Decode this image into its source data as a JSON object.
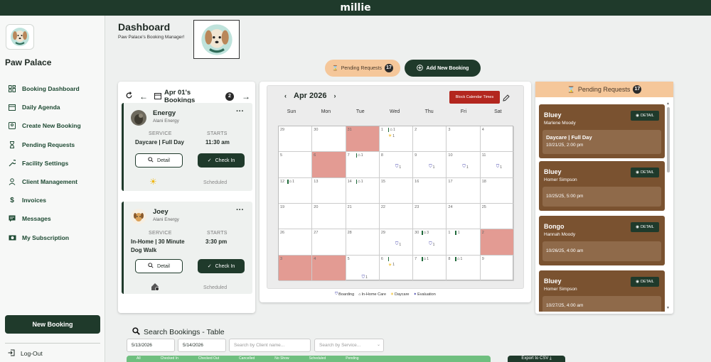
{
  "app": {
    "title": "millie"
  },
  "sidebar": {
    "brand": "Paw Palace",
    "items": [
      {
        "label": "Booking Dashboard",
        "icon": "dashboard-icon"
      },
      {
        "label": "Daily Agenda",
        "icon": "calendar-icon"
      },
      {
        "label": "Create New Booking",
        "icon": "booking-icon"
      },
      {
        "label": "Pending Requests",
        "icon": "hourglass-icon"
      },
      {
        "label": "Facility Settings",
        "icon": "wrench-icon"
      },
      {
        "label": "Client Management",
        "icon": "person-icon"
      },
      {
        "label": "Invoices",
        "icon": "dollar-icon"
      },
      {
        "label": "Messages",
        "icon": "message-icon"
      },
      {
        "label": "My Subscription",
        "icon": "money-icon"
      }
    ],
    "new_booking": "New Booking",
    "logout": "Log-Out"
  },
  "header": {
    "title": "Dashboard",
    "subtitle": "Paw Palace's Booking Manager!",
    "pending_label": "Pending Requests",
    "pending_count": "17",
    "add_booking": "Add New Booking"
  },
  "bookings": {
    "title": "Apr 01's Bookings",
    "count": "2",
    "cards": [
      {
        "name": "Energy",
        "owner": "Alani Energy",
        "service_label": "SERVICE",
        "service": "Daycare | Full Day",
        "starts_label": "STARTS",
        "starts": "11:30 am",
        "detail": "Detail",
        "checkin": "Check In",
        "status": "Scheduled"
      },
      {
        "name": "Joey",
        "owner": "Alani Energy",
        "service_label": "SERVICE",
        "service_line1": "In-Home | 30 Minute",
        "service_line2": "Dog Walk",
        "starts_label": "STARTS",
        "starts": "3:30 pm",
        "detail": "Detail",
        "checkin": "Check In",
        "status": "Scheduled"
      }
    ]
  },
  "calendar": {
    "month": "April 2026",
    "block_btn": "Block Calendar Times",
    "weekdays": [
      "Sun",
      "Mon",
      "Tue",
      "Wed",
      "Thu",
      "Fri",
      "Sat"
    ],
    "weeks": [
      [
        "29",
        "30",
        "31",
        "1",
        "2",
        "3",
        "4"
      ],
      [
        "5",
        "6",
        "7",
        "8",
        "9",
        "10",
        "11"
      ],
      [
        "12",
        "13",
        "14",
        "15",
        "16",
        "17",
        "18"
      ],
      [
        "19",
        "20",
        "21",
        "22",
        "23",
        "24",
        "25"
      ],
      [
        "26",
        "27",
        "28",
        "29",
        "30",
        "1",
        "2"
      ],
      [
        "3",
        "4",
        "5",
        "6",
        "7",
        "8",
        "9"
      ]
    ],
    "blocked": [
      [
        0,
        2
      ],
      [
        1,
        1
      ],
      [
        4,
        6
      ],
      [
        5,
        0
      ],
      [
        5,
        1
      ]
    ],
    "legend": [
      "Boarding",
      "In-Home Care",
      "Daycare",
      "Evaluation"
    ]
  },
  "pending": {
    "title": "Pending Requests",
    "count": "17",
    "detail_label": "DETAIL",
    "items": [
      {
        "name": "Bluey",
        "owner": "Marlene Moody",
        "service": "Daycare | Full Day",
        "date": "10/21/25, 2:00 pm"
      },
      {
        "name": "Bluey",
        "owner": "Homer Simpson",
        "service": "",
        "date": "10/25/25, 5:00 pm"
      },
      {
        "name": "Bongo",
        "owner": "Hannah Moody",
        "service": "",
        "date": "10/26/25, 4:00 am"
      },
      {
        "name": "Bluey",
        "owner": "Homer Simpson",
        "service": "",
        "date": "10/27/25, 4:00 am"
      }
    ]
  },
  "search": {
    "title": "Search Bookings - Table",
    "start_date": "5/13/2026",
    "end_date": "5/14/2026",
    "client_placeholder": "Search by Client name...",
    "service_placeholder": "Search by Service...",
    "export": "Export to CSV",
    "columns": [
      "All",
      "Checked In",
      "Checked Out",
      "Cancelled",
      "No Show",
      "Scheduled",
      "Pending"
    ]
  }
}
